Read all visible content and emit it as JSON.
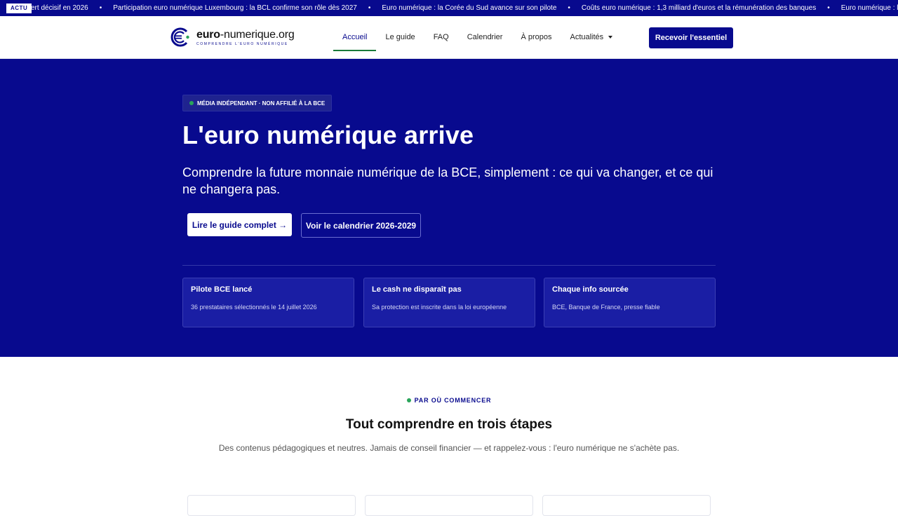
{
  "ticker": {
    "badge": "ACTU",
    "items": [
      "ert décisif en 2026",
      "Participation euro numérique Luxembourg : la BCL confirme son rôle dès 2027",
      "Euro numérique : la Corée du Sud avance sur son pilote",
      "Coûts euro numérique : 1,3 milliard d'euros et la rémunération des banques",
      "Euro numérique : le Parlement confirme, un pi"
    ],
    "separator": "•"
  },
  "header": {
    "logo_name_bold": "euro",
    "logo_name_rest": "-numerique.org",
    "logo_tagline": "COMPRENDRE L'EURO NUMÉRIQUE",
    "nav": [
      "Accueil",
      "Le guide",
      "FAQ",
      "Calendrier",
      "À propos",
      "Actualités"
    ],
    "active_nav": "Accueil",
    "cta": "Recevoir l'essentiel"
  },
  "hero": {
    "badge": "MÉDIA INDÉPENDANT · NON AFFILIÉ À LA BCE",
    "title": "L'euro numérique arrive",
    "subtitle": "Comprendre la future monnaie numérique de la BCE, simplement : ce qui va changer, et ce qui ne changera pas.",
    "primary_button": "Lire le guide complet →",
    "secondary_button": "Voir le calendrier 2026-2029",
    "features": [
      {
        "title": "Pilote BCE lancé",
        "desc": "36 prestataires sélectionnés le 14 juillet 2026"
      },
      {
        "title": "Le cash ne disparaît pas",
        "desc": "Sa protection est inscrite dans la loi européenne"
      },
      {
        "title": "Chaque info sourcée",
        "desc": "BCE, Banque de France, presse fiable"
      }
    ]
  },
  "section": {
    "eyebrow": "PAR OÙ COMMENCER",
    "title": "Tout comprendre en trois étapes",
    "lead": "Des contenus pédagogiques et neutres. Jamais de conseil financier — et rappelez-vous : l'euro numérique ne s'achète pas."
  },
  "colors": {
    "brand": "#080a8e",
    "accent_green": "#2aa45a",
    "white": "#ffffff"
  },
  "icons": {
    "logo": "euro-logo-icon",
    "dropdown": "chevron-down-icon",
    "status": "green-dot-icon"
  }
}
